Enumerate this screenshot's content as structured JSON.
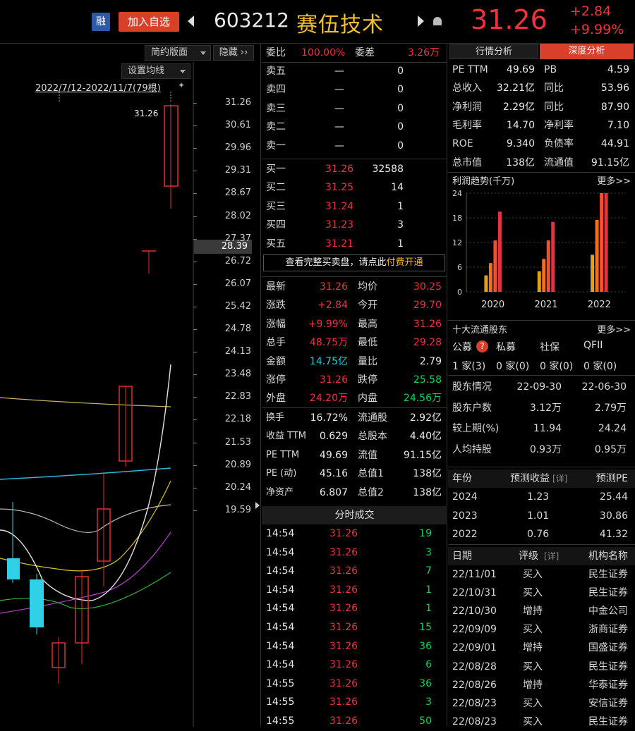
{
  "header": {
    "rong": "融",
    "add": "加入自选",
    "code": "603212",
    "name": "赛伍技术",
    "price": "31.26",
    "change": "+2.84",
    "pct": "+9.99%"
  },
  "chart": {
    "simple_btn": "简约版面",
    "hide_btn": "隐藏",
    "ma_btn": "设置均线",
    "range": "2022/7/12-2022/11/7(79根)",
    "high_label": "31.26",
    "axis": [
      "31.26",
      "30.61",
      "29.96",
      "29.31",
      "28.67",
      "28.02",
      "27.37",
      "26.72",
      "26.07",
      "25.42",
      "24.78",
      "24.13",
      "23.48",
      "22.83",
      "22.18",
      "21.53",
      "20.89",
      "20.24",
      "19.59"
    ],
    "cursor": "28.39"
  },
  "orders": {
    "webi_label": "委比",
    "webi": "100.00%",
    "wecha_label": "委差",
    "wecha": "3.26万",
    "sells": [
      {
        "l": "卖五",
        "p": "—",
        "v": "0"
      },
      {
        "l": "卖四",
        "p": "—",
        "v": "0"
      },
      {
        "l": "卖三",
        "p": "—",
        "v": "0"
      },
      {
        "l": "卖二",
        "p": "—",
        "v": "0"
      },
      {
        "l": "卖一",
        "p": "—",
        "v": "0"
      }
    ],
    "buys": [
      {
        "l": "买一",
        "p": "31.26",
        "v": "32588"
      },
      {
        "l": "买二",
        "p": "31.25",
        "v": "14"
      },
      {
        "l": "买三",
        "p": "31.24",
        "v": "1"
      },
      {
        "l": "买四",
        "p": "31.23",
        "v": "3"
      },
      {
        "l": "买五",
        "p": "31.21",
        "v": "1"
      }
    ],
    "banner": "查看完整买卖盘，请点此",
    "banner_link": "付费开通"
  },
  "stats": [
    [
      "最新",
      "31.26",
      "均价",
      "30.25"
    ],
    [
      "涨跌",
      "+2.84",
      "今开",
      "29.70"
    ],
    [
      "涨幅",
      "+9.99%",
      "最高",
      "31.26"
    ],
    [
      "总手",
      "48.75万",
      "最低",
      "29.28"
    ],
    [
      "金额",
      "14.75亿",
      "量比",
      "2.79"
    ],
    [
      "涨停",
      "31.26",
      "跌停",
      "25.58"
    ],
    [
      "外盘",
      "24.20万",
      "内盘",
      "24.56万"
    ]
  ],
  "stats2": [
    [
      "换手",
      "16.72%",
      "流通股",
      "2.92亿"
    ],
    [
      "收益 TTM",
      "0.629",
      "总股本",
      "4.40亿"
    ],
    [
      "PE TTM",
      "49.69",
      "流值",
      "91.15亿"
    ],
    [
      "PE (动)",
      "45.16",
      "总值1",
      "138亿"
    ],
    [
      "净资产",
      "6.807",
      "总值2",
      "138亿"
    ]
  ],
  "ticks": {
    "title": "分时成交",
    "rows": [
      [
        "14:54",
        "31.26",
        "19"
      ],
      [
        "14:54",
        "31.26",
        "3"
      ],
      [
        "14:54",
        "31.26",
        "7"
      ],
      [
        "14:54",
        "31.26",
        "1"
      ],
      [
        "14:54",
        "31.26",
        "1"
      ],
      [
        "14:54",
        "31.26",
        "15"
      ],
      [
        "14:54",
        "31.26",
        "36"
      ],
      [
        "14:54",
        "31.26",
        "6"
      ],
      [
        "14:55",
        "31.26",
        "36"
      ],
      [
        "14:55",
        "31.26",
        "3"
      ],
      [
        "14:55",
        "31.26",
        "50"
      ]
    ]
  },
  "right": {
    "tab1": "行情分析",
    "tab2": "深度分析",
    "fund": [
      [
        "PE TTM",
        "49.69",
        "PB",
        "4.59"
      ],
      [
        "总收入",
        "32.21亿",
        "同比",
        "53.96"
      ],
      [
        "净利润",
        "2.29亿",
        "同比",
        "87.90"
      ],
      [
        "毛利率",
        "14.70",
        "净利率",
        "7.10"
      ],
      [
        "ROE",
        "9.340",
        "负债率",
        "44.91"
      ],
      [
        "总市值",
        "138亿",
        "流通值",
        "91.15亿"
      ]
    ],
    "profit_title": "利润趋势(千万)",
    "more": "更多>>",
    "holders_title": "十大流通股东",
    "holder_tabs": [
      "公募",
      "私募",
      "社保",
      "QFII"
    ],
    "holder_counts": [
      "1 家(3)",
      "0 家(0)",
      "0 家(0)",
      "0 家(0)"
    ],
    "sh": [
      [
        "股东情况",
        "22-09-30",
        "22-06-30"
      ],
      [
        "股东户数",
        "3.12万",
        "2.79万"
      ],
      [
        "较上期(%)",
        "11.94",
        "24.24"
      ],
      [
        "人均持股",
        "0.93万",
        "0.95万"
      ]
    ],
    "fc_head": [
      "年份",
      "预测收益",
      "[详]",
      "预测PE"
    ],
    "fc": [
      [
        "2024",
        "1.23",
        "25.44"
      ],
      [
        "2023",
        "1.01",
        "30.86"
      ],
      [
        "2022",
        "0.76",
        "41.32"
      ]
    ],
    "rt_head": [
      "日期",
      "评级",
      "[详]",
      "机构名称"
    ],
    "rt": [
      [
        "22/11/01",
        "买入",
        "民生证券"
      ],
      [
        "22/10/31",
        "买入",
        "民生证券"
      ],
      [
        "22/10/30",
        "增持",
        "中金公司"
      ],
      [
        "22/09/09",
        "买入",
        "浙商证券"
      ],
      [
        "22/09/01",
        "增持",
        "国盛证券"
      ],
      [
        "22/08/28",
        "买入",
        "民生证券"
      ],
      [
        "22/08/26",
        "增持",
        "华泰证券"
      ],
      [
        "22/08/23",
        "买入",
        "安信证券"
      ],
      [
        "22/08/23",
        "买入",
        "民生证券"
      ]
    ]
  },
  "chart_data": {
    "type": "bar",
    "title": "利润趋势(千万)",
    "categories": [
      "2020",
      "2021",
      "2022"
    ],
    "yticks": [
      "24",
      "18",
      "12",
      "6",
      "0"
    ],
    "ylim": [
      0,
      24
    ],
    "series": [
      {
        "values": [
          4,
          5,
          9
        ]
      },
      {
        "values": [
          7,
          8,
          17.5
        ]
      },
      {
        "values": [
          12.5,
          12.5,
          24
        ]
      },
      {
        "values": [
          19.5,
          17,
          24
        ]
      }
    ]
  }
}
